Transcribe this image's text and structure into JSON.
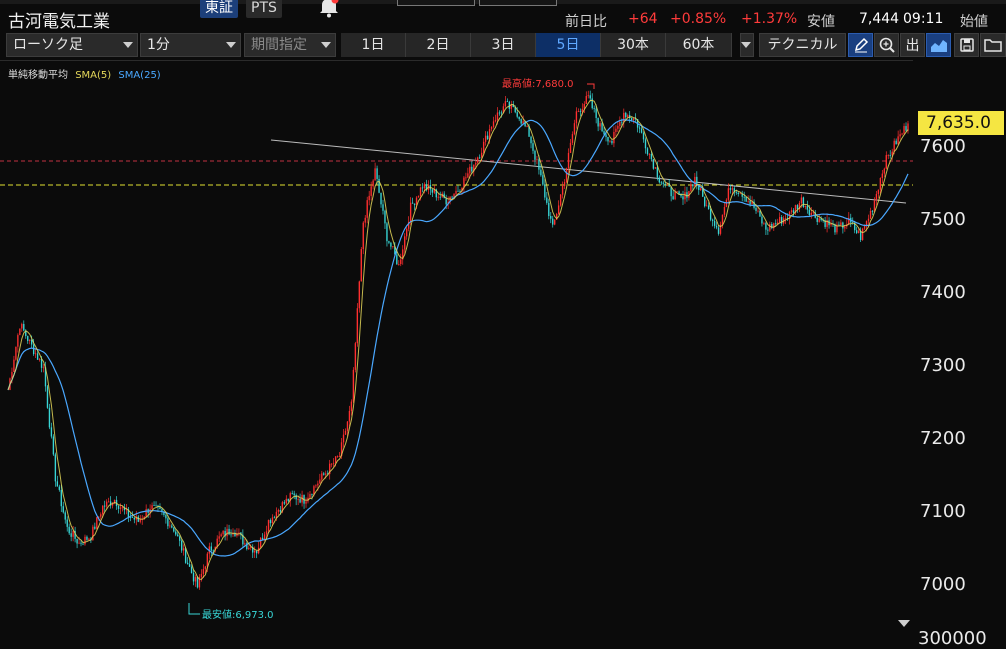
{
  "header": {
    "stock_name": "古河電気工業",
    "exchange_active": "東証",
    "exchange_other": "PTS",
    "prev_day_label": "前日比",
    "change_value": "+64",
    "change_pct": "+0.85%",
    "change_pct2": "+1.37%",
    "low_label": "安値",
    "low_value": "7,444",
    "time": "09:11",
    "open_label": "始値"
  },
  "toolbar": {
    "chart_type": "ローソク足",
    "interval": "1分",
    "period_placeholder": "期間指定",
    "ranges": [
      "1日",
      "2日",
      "3日",
      "5日",
      "30本",
      "60本"
    ],
    "active_range": "5日",
    "technical_label": "テクニカル",
    "icons": [
      "pencil-icon",
      "zoom-icon",
      "volume-icon",
      "area-chart-icon",
      "save-icon",
      "folder-icon"
    ],
    "volume_label": "出"
  },
  "legend": {
    "title": "単純移動平均",
    "sma5": "SMA(5)",
    "sma25": "SMA(25)"
  },
  "chart": {
    "high_annotation": "最高値:7,680.0",
    "low_annotation": "最安値:6,973.0",
    "current_price": "7,635.0",
    "y_ticks": [
      "7600",
      "7500",
      "7400",
      "7300",
      "7200",
      "7100",
      "7000"
    ],
    "bottom_tick": "300000",
    "colors": {
      "up": "#ff2f2f",
      "down": "#38d6d6",
      "sma5": "#e5d85a",
      "sma25": "#4aa8ff",
      "trendline": "#bbbbbb",
      "prev_close_line": "#e0e030",
      "resistance_line": "#c03040"
    }
  },
  "chart_data": {
    "type": "line",
    "title": "",
    "ylim": [
      6950,
      7690
    ],
    "y_ticks": [
      7000,
      7100,
      7200,
      7300,
      7400,
      7500,
      7600
    ],
    "series": [
      {
        "name": "",
        "values": [
          7270,
          7360,
          7330,
          7300,
          7150,
          7080,
          7060,
          7070,
          7110,
          7120,
          7100,
          7090,
          7110,
          7100,
          7080,
          7040,
          7000,
          7050,
          7070,
          7080,
          7060,
          7050,
          7090,
          7110,
          7125,
          7120,
          7140,
          7160,
          7180,
          7250,
          7500,
          7570,
          7480,
          7440,
          7520,
          7550,
          7540,
          7530,
          7545,
          7570,
          7600,
          7640,
          7660,
          7650,
          7620,
          7560,
          7490,
          7560,
          7650,
          7670,
          7630,
          7610,
          7650,
          7640,
          7600,
          7560,
          7540,
          7530,
          7560,
          7520,
          7490,
          7550,
          7540,
          7520,
          7490,
          7500,
          7510,
          7530,
          7510,
          7500,
          7490,
          7500,
          7480,
          7520,
          7580,
          7610,
          7635
        ]
      }
    ],
    "annotations": [
      "最高値:7,680.0",
      "最安値:6,973.0"
    ]
  }
}
